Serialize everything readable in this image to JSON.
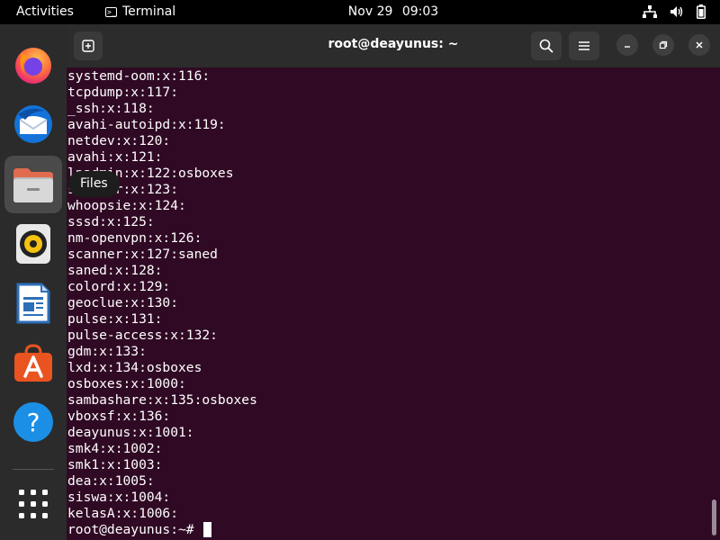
{
  "topbar": {
    "activities": "Activities",
    "app_name": "Terminal",
    "clock": {
      "date": "Nov 29",
      "time": "09:03"
    },
    "tray_icons": [
      "network-icon",
      "volume-icon",
      "battery-icon"
    ]
  },
  "dock": {
    "apps": [
      {
        "name": "Firefox",
        "icon": "firefox-icon"
      },
      {
        "name": "Thunderbird",
        "icon": "thunderbird-icon"
      },
      {
        "name": "Files",
        "icon": "files-icon",
        "active": true
      },
      {
        "name": "Rhythmbox",
        "icon": "rhythmbox-icon"
      },
      {
        "name": "LibreOffice Writer",
        "icon": "writer-icon"
      },
      {
        "name": "Ubuntu Software",
        "icon": "software-icon"
      },
      {
        "name": "Help",
        "icon": "help-icon"
      },
      {
        "name": "Show Applications",
        "icon": "apps-grid-icon"
      }
    ],
    "tooltip": "Files"
  },
  "window": {
    "title": "root@deayunus: ~"
  },
  "terminal": {
    "lines": [
      "systemd-oom:x:116:",
      "tcpdump:x:117:",
      "_ssh:x:118:",
      "avahi-autoipd:x:119:",
      "netdev:x:120:",
      "avahi:x:121:",
      "lpadmin:x:122:osboxes",
      "scanner:x:123:",
      "whoopsie:x:124:",
      "sssd:x:125:",
      "nm-openvpn:x:126:",
      "scanner:x:127:saned",
      "saned:x:128:",
      "colord:x:129:",
      "geoclue:x:130:",
      "pulse:x:131:",
      "pulse-access:x:132:",
      "gdm:x:133:",
      "lxd:x:134:osboxes",
      "osboxes:x:1000:",
      "sambashare:x:135:osboxes",
      "vboxsf:x:136:",
      "deayunus:x:1001:",
      "smk4:x:1002:",
      "smk1:x:1003:",
      "dea:x:1005:",
      "siswa:x:1004:",
      "kelasA:x:1006:"
    ],
    "prompt": "root@deayunus:~# "
  },
  "colors": {
    "terminal_bg": "#300a24",
    "headerbar_bg": "#2c2c2c",
    "dock_bg": "#2b2b2b",
    "accent_orange": "#e95420"
  }
}
